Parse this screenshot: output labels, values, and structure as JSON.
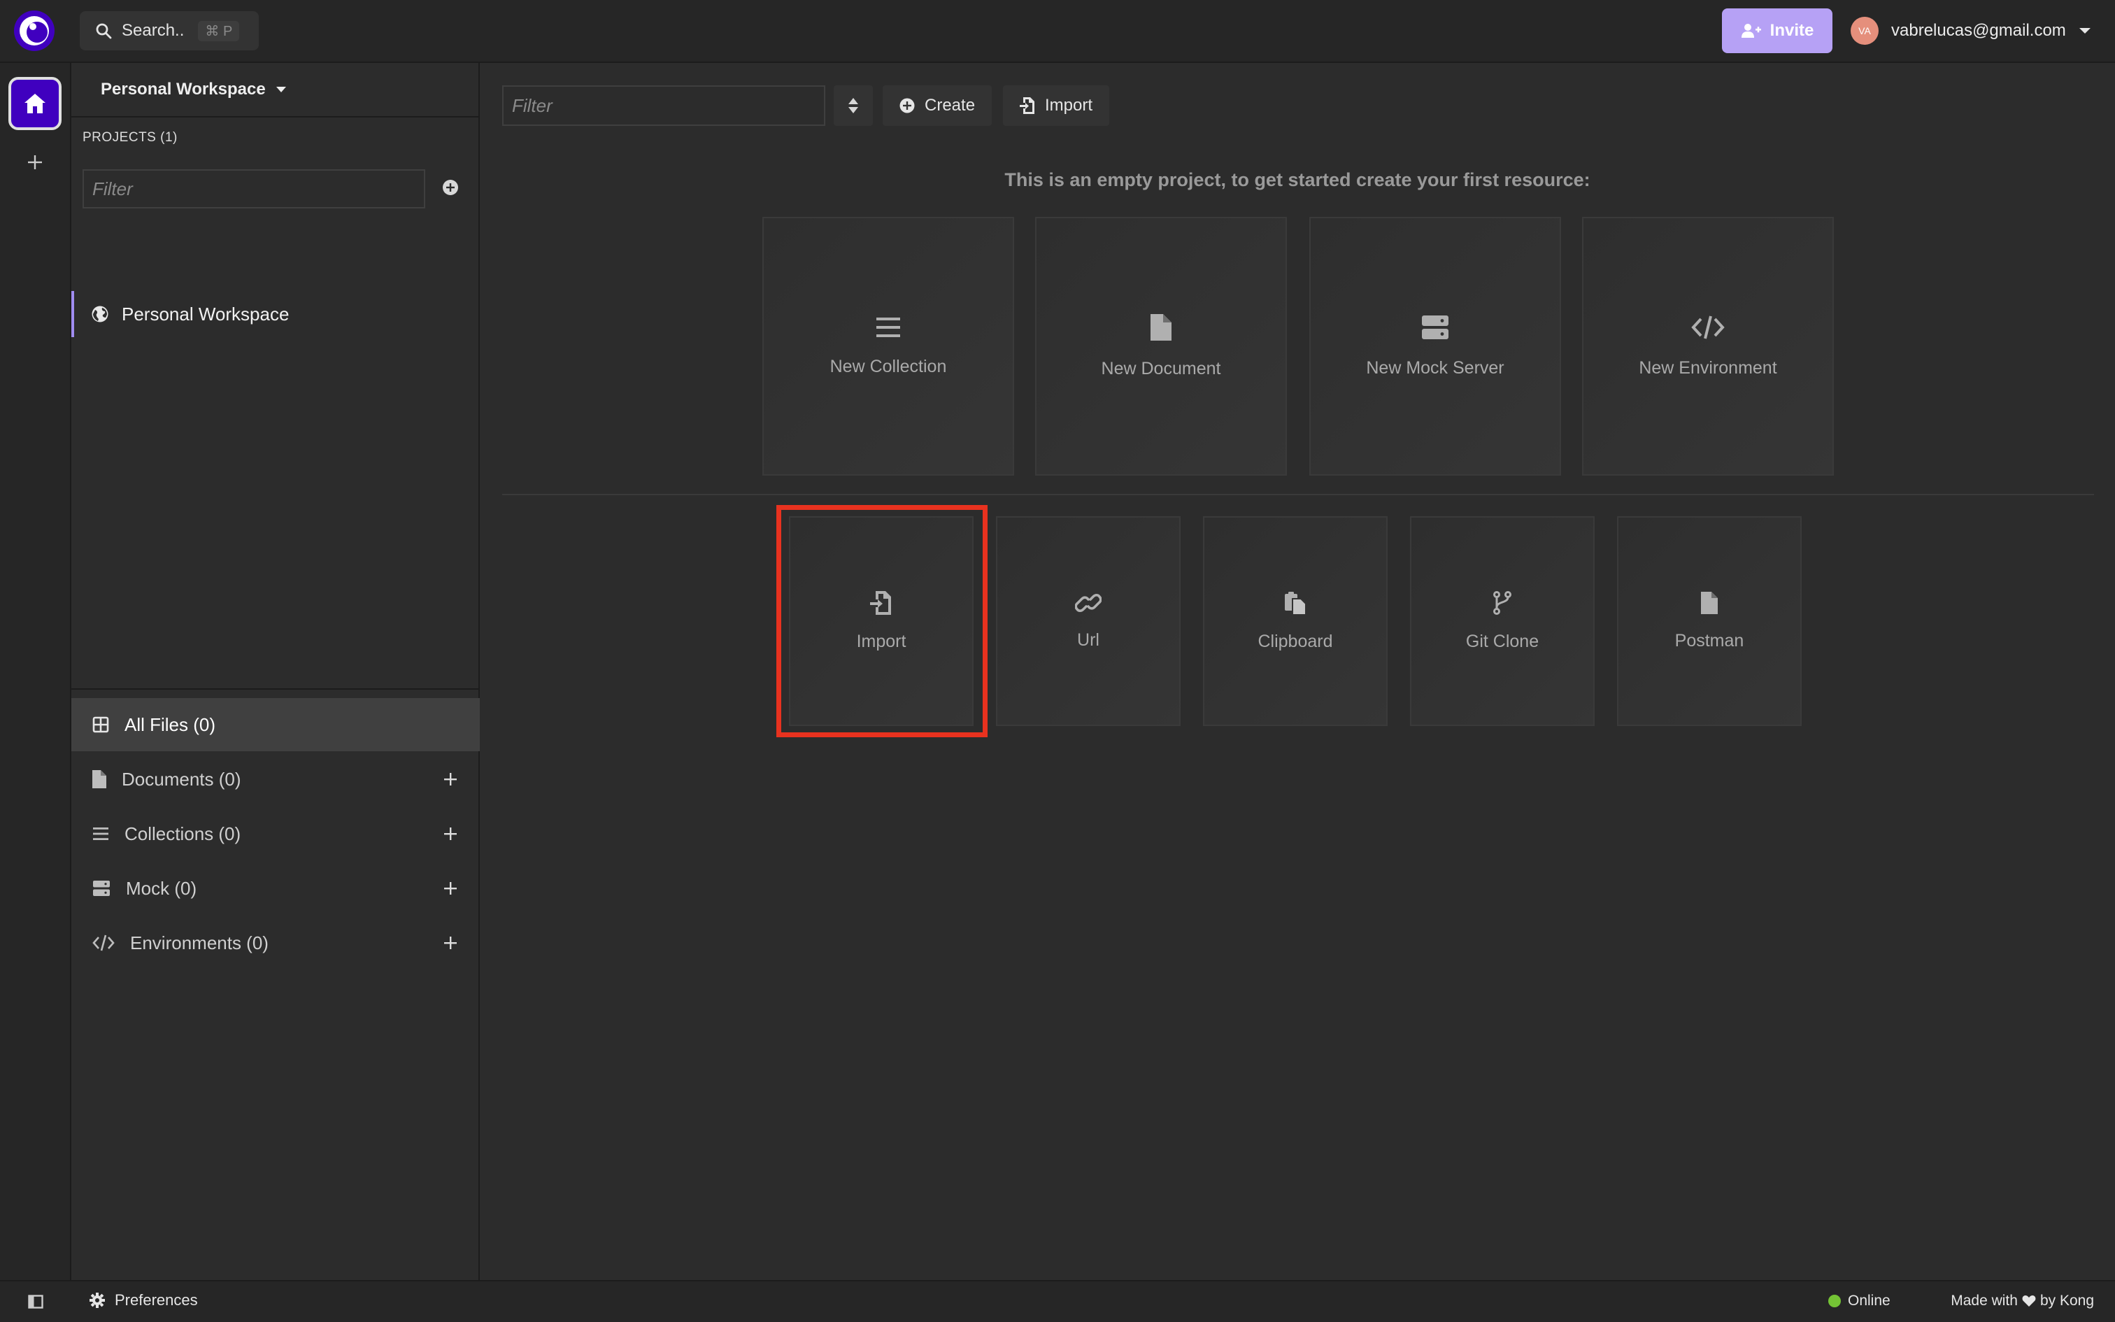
{
  "topbar": {
    "search_label": "Search..",
    "search_shortcut": "⌘ P",
    "invite_label": "Invite",
    "avatar_initials": "VA",
    "account_email": "vabrelucas@gmail.com"
  },
  "sidebar": {
    "workspace_title": "Personal Workspace",
    "projects_label": "PROJECTS (1)",
    "filter_placeholder": "Filter",
    "project_item": "Personal Workspace",
    "files": [
      {
        "label": "All Files (0)"
      },
      {
        "label": "Documents (0)"
      },
      {
        "label": "Collections (0)"
      },
      {
        "label": "Mock (0)"
      },
      {
        "label": "Environments (0)"
      }
    ]
  },
  "main": {
    "filter_placeholder": "Filter",
    "create_label": "Create",
    "import_label": "Import",
    "empty_message": "This is an empty project, to get started create your first resource:",
    "create_cards": [
      {
        "label": "New Collection",
        "icon": "list-icon"
      },
      {
        "label": "New Document",
        "icon": "document-icon"
      },
      {
        "label": "New Mock Server",
        "icon": "server-icon"
      },
      {
        "label": "New Environment",
        "icon": "code-icon"
      }
    ],
    "import_cards": [
      {
        "label": "Import",
        "icon": "file-import-icon"
      },
      {
        "label": "Url",
        "icon": "link-icon"
      },
      {
        "label": "Clipboard",
        "icon": "clipboard-icon"
      },
      {
        "label": "Git Clone",
        "icon": "git-branch-icon"
      },
      {
        "label": "Postman",
        "icon": "file-icon"
      }
    ]
  },
  "footer": {
    "preferences_label": "Preferences",
    "status_label": "Online",
    "made_with_prefix": "Made with",
    "made_with_suffix": "by Kong"
  },
  "colors": {
    "brand": "#4000bf",
    "invite": "#b6a1f5",
    "highlight": "#e8321f",
    "online": "#74c335"
  }
}
